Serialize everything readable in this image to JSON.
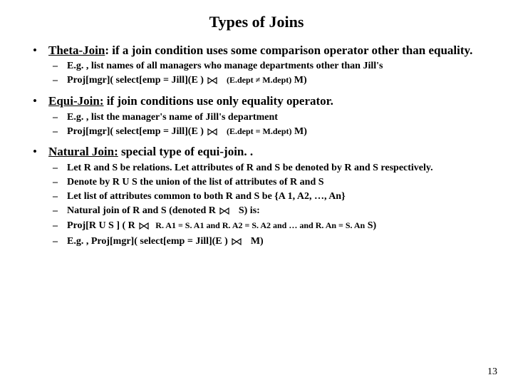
{
  "title": "Types of Joins",
  "bullets": {
    "theta": {
      "head_underlined": "Theta-Join",
      "head_rest": ": if a join condition uses some comparison operator other than equality.",
      "s1": "E.g. , list names of all managers who manage departments other than Jill's",
      "s2a": " Proj[mgr]( select[emp = Jill](E )",
      "s2cond": "(E.dept ≠ M.dept)",
      "s2b": " M)"
    },
    "equi": {
      "head_underlined": "Equi-Join",
      "head_colon": ":",
      "head_rest": " if join conditions use only equality operator.",
      "s1": "E.g. , list the manager's name of Jill's department",
      "s2a": "Proj[mgr]( select[emp = Jill](E )",
      "s2cond": "(E.dept = M.dept)",
      "s2b": " M)"
    },
    "natural": {
      "head_underlined": "Natural Join",
      "head_colon": ":",
      "head_rest": " special type of equi-join. .",
      "s1": "Let R and S be relations. Let attributes of R and S be denoted by R and S respectively.",
      "s2": "Denote by R U S the union of the list of attributes of R and S",
      "s3": "Let list of attributes common to both R and S  be {A 1, A2, …, An}",
      "s4a": "Natural join of R and S (denoted R",
      "s4b": "S) is:",
      "s5a": " Proj[R U S ] ( R",
      "s5cond": "R. A1 = S. A1 and R. A2 = S. A2 and … and R. An = S. An",
      "s5b": " S)",
      "s6a": "E.g. , Proj[mgr]( select[emp = Jill](E )",
      "s6b": "M)"
    }
  },
  "pagenum": "13"
}
